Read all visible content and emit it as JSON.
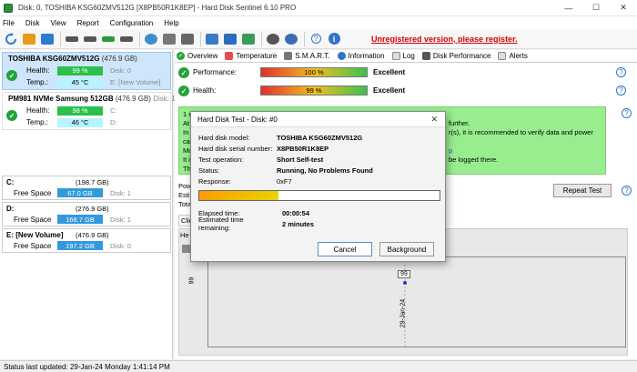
{
  "window": {
    "title": "Disk: 0, TOSHIBA KSG60ZMV512G [X8PB50R1K8EP]  -  Hard Disk Sentinel 6.10 PRO"
  },
  "menu": [
    "File",
    "Disk",
    "View",
    "Report",
    "Configuration",
    "Help"
  ],
  "toolbar": {
    "unregistered": "Unregistered version, please register."
  },
  "disks": [
    {
      "name": "TOSHIBA KSG60ZMV512G",
      "size": "(476.9 GB)",
      "health_label": "Health:",
      "health": "99 %",
      "health_right": "Disk: 0",
      "temp_label": "Temp.:",
      "temp": "45 °C",
      "temp_right": "E: [New Volume]"
    },
    {
      "name": "PM981 NVMe Samsung 512GB",
      "size": "(476.9 GB)",
      "size_right": "Disk: 1",
      "health_label": "Health:",
      "health": "98 %",
      "health_right": "C:",
      "temp_label": "Temp.:",
      "temp": "46 °C",
      "temp_right": "D:"
    }
  ],
  "volumes": [
    {
      "name": "C:",
      "size": "(198.7 GB)",
      "free_label": "Free Space",
      "free": "67.0 GB",
      "disk": "Disk: 1"
    },
    {
      "name": "D:",
      "size": "(276.9 GB)",
      "free_label": "Free Space",
      "free": "168.7 GB",
      "disk": "Disk: 1"
    },
    {
      "name": "E: [New Volume]",
      "size": "(476.9 GB)",
      "free_label": "Free Space",
      "free": "197.2 GB",
      "disk": "Disk: 0"
    }
  ],
  "tabs": [
    "Overview",
    "Temperature",
    "S.M.A.R.T.",
    "Information",
    "Log",
    "Disk Performance",
    "Alerts"
  ],
  "metrics": {
    "performance": {
      "label": "Performance:",
      "value": "100 %",
      "text": "Excellent",
      "fraction": 1.0
    },
    "health": {
      "label": "Health:",
      "value": "99 %",
      "text": "Excellent",
      "fraction": 0.99
    }
  },
  "message": {
    "lines_left": [
      "1 errors occurred during data transfer.",
      "At th",
      "In c",
      "cab",
      "Mor",
      "It is",
      "The"
    ],
    "lines_right": [
      "further.",
      "r(s), it is recommended to verify data and power",
      "",
      "p",
      "be logged there.",
      ""
    ]
  },
  "side_labels": [
    "Pow",
    "Estin",
    "Tota",
    "Clic"
  ],
  "repeat_test": "Repeat Test",
  "graph": {
    "head": "He",
    "y_value": "99",
    "point_label": "99",
    "x_label": "29-Jan-24"
  },
  "status": "Status last updated: 29-Jan-24 Monday 1:41:14 PM",
  "dialog": {
    "title": "Hard Disk Test - Disk: #0",
    "model_label": "Hard disk model:",
    "model": "TOSHIBA KSG60ZMV512G",
    "serial_label": "Hard disk serial number:",
    "serial": "X8PB50R1K8EP",
    "op_label": "Test operation:",
    "op": "Short Self-test",
    "status_label": "Status:",
    "status": "Running, No Problems Found",
    "resp_label": "Response:",
    "resp": "0xF7",
    "progress": 0.33,
    "elapsed_label": "Elapsed time:",
    "elapsed": "00:00:54",
    "remain_label": "Estimated time remaining:",
    "remain": "2 minutes",
    "cancel": "Cancel",
    "background": "Background"
  }
}
